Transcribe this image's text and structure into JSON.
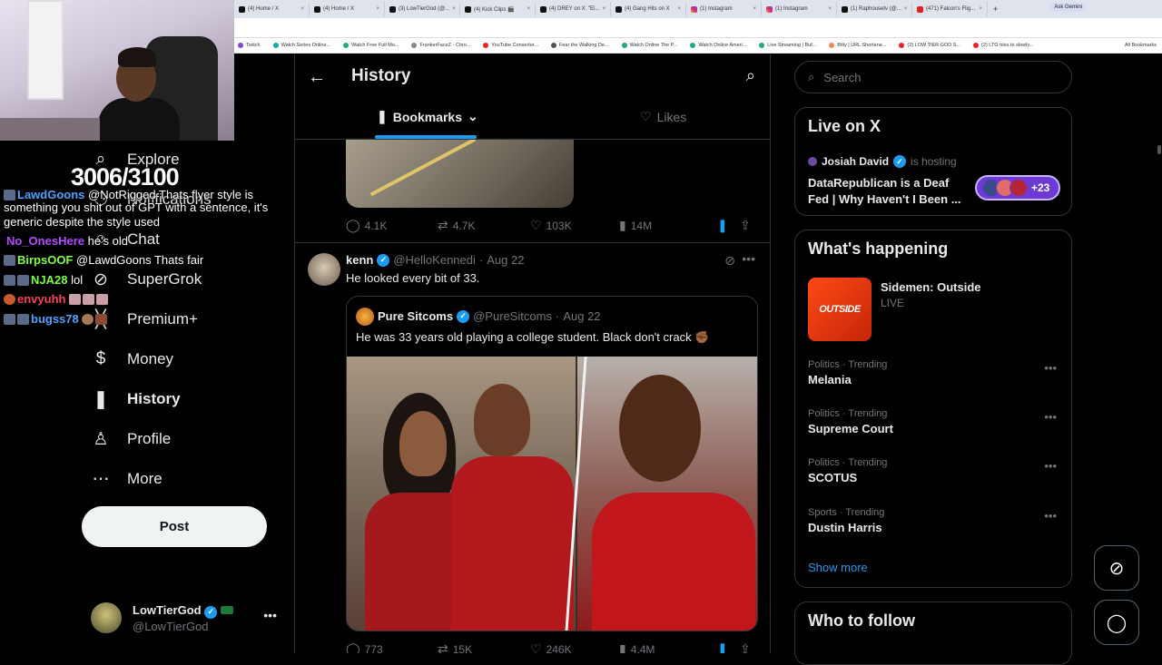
{
  "browser": {
    "tabs": [
      "(4) Home / X",
      "(4) Home / X",
      "(3) LowTierGod (@...",
      "(4) Kick Clips 🎬",
      "(4) DREY on X: \"El...",
      "(4) Gang Hits on X",
      "(1) Instagram",
      "(1) Instagram",
      "(1) Raphousetv (@...",
      "(471) Falcon's Flig..."
    ],
    "tab_icons": [
      "x-icon",
      "x-icon",
      "x-icon",
      "x-icon",
      "x-icon",
      "x-icon",
      "instagram-icon",
      "instagram-icon",
      "x-icon",
      "youtube-icon"
    ],
    "new_tab": "+",
    "ask_gemini": "Ask Gemini",
    "bookmarks": [
      "Twitch",
      "Watch Series Online...",
      "Watch Free Full Mo...",
      "FrankerFaceZ - Chro...",
      "YouTube Converter...",
      "Fear the Walking De...",
      "Watch Online The P...",
      "Watch Online Ameri...",
      "Live Streaming | Buf...",
      "Bitly | URL Shortene...",
      "(2) LOW TIER GOD S...",
      "(2) LTG tries to slowly..."
    ],
    "all_bookmarks": "All Bookmarks"
  },
  "stream_overlay": {
    "counter": "3006/3100",
    "chat": [
      {
        "user": "LawdGoons",
        "text": "@NotRigged Thats flyer style is",
        "color": "#4aa3ff"
      },
      {
        "user": "",
        "text": "something you shit out of GPT with a sentence, it's",
        "color": "#ffffff"
      },
      {
        "user": "",
        "text": "generic despite the style used",
        "color": "#ffffff"
      },
      {
        "user": "No_OnesHere",
        "text": "he's old",
        "color": "#b44bff"
      },
      {
        "user": "BirpsOOF",
        "text": "@LawdGoons Thats fair",
        "color": "#7bff3f"
      },
      {
        "user": "NJA28",
        "text": "lol",
        "color": "#7bff3f"
      },
      {
        "user": "envyuhh",
        "text": "",
        "color": "#ff3f5a"
      },
      {
        "user": "bugss78",
        "text": "",
        "color": "#4aa3ff"
      }
    ]
  },
  "sidebar": {
    "items": [
      {
        "label": "Explore",
        "icon": "search-icon",
        "glyph": "⌕"
      },
      {
        "label": "Notifications",
        "icon": "bell-icon",
        "glyph": "⚆"
      },
      {
        "label": "Chat",
        "icon": "chat-icon",
        "glyph": "○"
      },
      {
        "label": "SuperGrok",
        "icon": "grok-icon",
        "glyph": "⊘"
      },
      {
        "label": "Premium+",
        "icon": "x-logo-icon",
        "glyph": "╳"
      },
      {
        "label": "Money",
        "icon": "money-icon",
        "glyph": "$"
      },
      {
        "label": "History",
        "icon": "bookmark-icon",
        "glyph": "❚"
      },
      {
        "label": "Profile",
        "icon": "person-icon",
        "glyph": "♙"
      },
      {
        "label": "More",
        "icon": "more-circle-icon",
        "glyph": "⋯"
      }
    ],
    "active": "History",
    "post_label": "Post",
    "account": {
      "name": "LowTierGod",
      "handle": "@LowTierGod"
    }
  },
  "main": {
    "title": "History",
    "tabs": [
      {
        "label": "Bookmarks",
        "icon": "bookmark-icon",
        "active": true
      },
      {
        "label": "Likes",
        "icon": "heart-icon",
        "active": false
      }
    ],
    "previous_tweet": {
      "replies": "4.1K",
      "reposts": "4.7K",
      "likes": "103K",
      "views": "14M"
    },
    "tweet": {
      "name": "kenn",
      "handle": "@HelloKennedi",
      "date": "Aug 22",
      "text": "He looked every bit of 33.",
      "quote": {
        "name": "Pure Sitcoms",
        "handle": "@PureSitcoms",
        "date": "Aug 22",
        "text": "He was 33 years old playing a college student. Black don't crack ✊🏾"
      },
      "replies": "773",
      "reposts": "15K",
      "likes": "246K",
      "views": "4.4M"
    }
  },
  "right": {
    "search_placeholder": "Search",
    "live": {
      "title": "Live on X",
      "host": "Josiah David",
      "host_suffix": "is hosting",
      "space_title": "DataRepublican is a Deaf Fed | Why Haven't I Been ...",
      "listeners": "+23"
    },
    "happening": {
      "title": "What's happening",
      "event": {
        "name": "Sidemen: Outside",
        "status": "LIVE",
        "image_text": "OUTSIDE"
      },
      "trends": [
        {
          "category": "Politics · Trending",
          "topic": "Melania"
        },
        {
          "category": "Politics · Trending",
          "topic": "Supreme Court"
        },
        {
          "category": "Politics · Trending",
          "topic": "SCOTUS"
        },
        {
          "category": "Sports · Trending",
          "topic": "Dustin Harris"
        }
      ],
      "show_more": "Show more"
    },
    "who_to_follow": "Who to follow"
  },
  "colors": {
    "accent": "#1d9bf0",
    "background": "#000000",
    "border": "#2f3336",
    "muted": "#71767b",
    "live_pill": "#6e3ad6"
  }
}
